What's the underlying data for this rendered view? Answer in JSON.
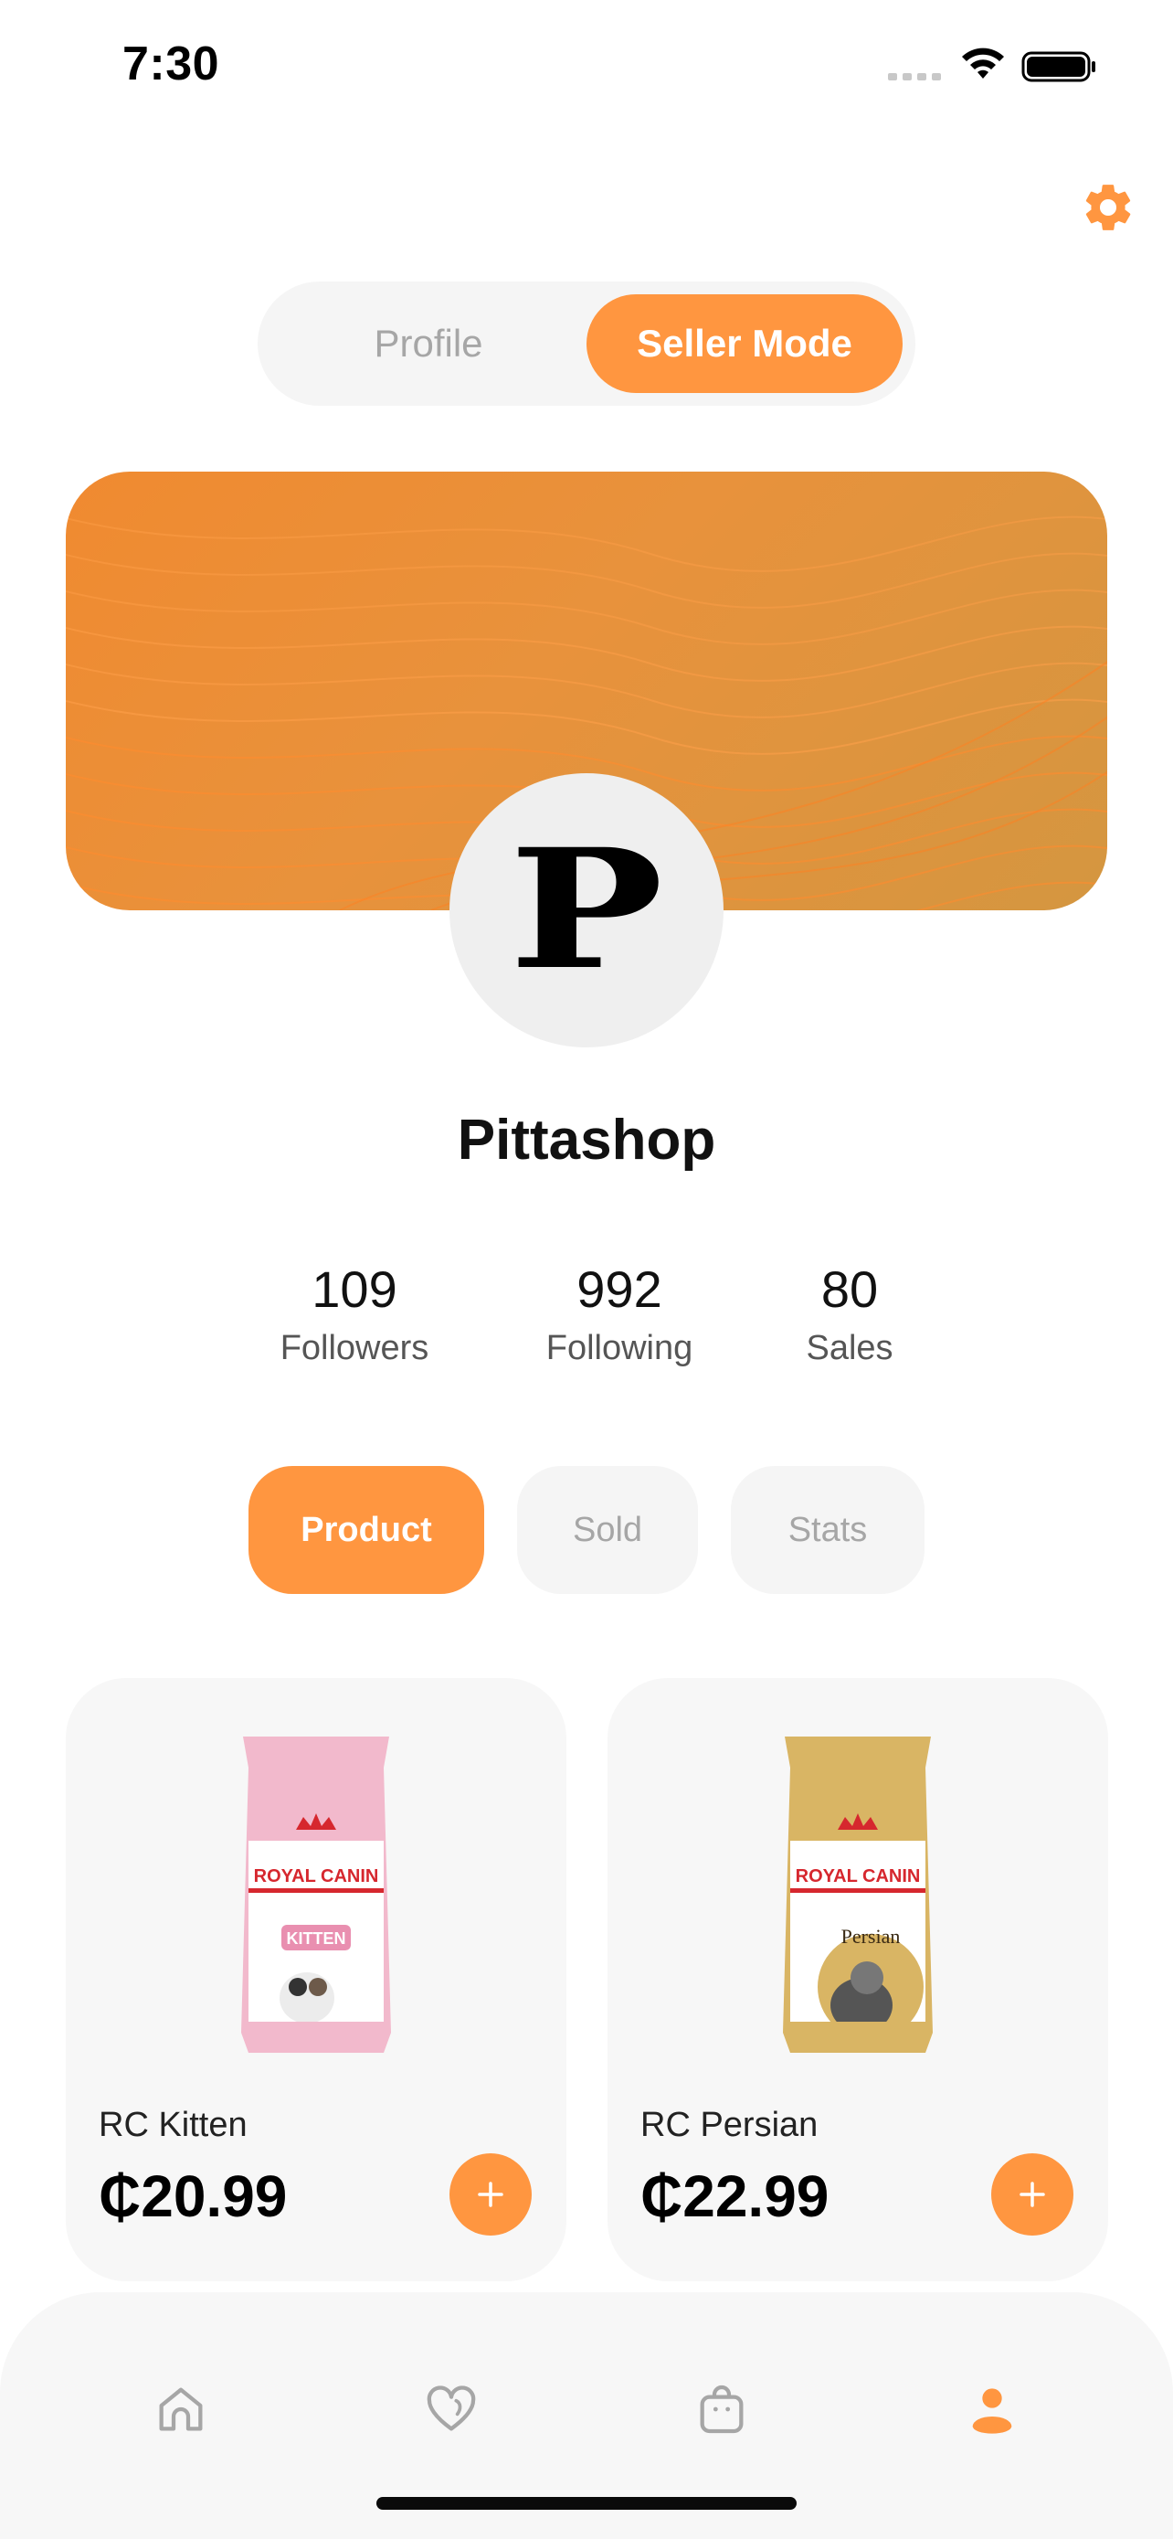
{
  "status_bar": {
    "time": "7:30"
  },
  "colors": {
    "accent": "#ff9640",
    "surface": "#f7f7f7",
    "inactive": "#a6a6a6"
  },
  "mode_toggle": {
    "profile_label": "Profile",
    "seller_label": "Seller Mode",
    "selected": "Seller Mode"
  },
  "profile": {
    "avatar_letter": "P",
    "shop_name": "Pittashop",
    "stats": [
      {
        "value": "109",
        "label": "Followers"
      },
      {
        "value": "992",
        "label": "Following"
      },
      {
        "value": "80",
        "label": "Sales"
      }
    ]
  },
  "tabs": [
    {
      "label": "Product",
      "active": true
    },
    {
      "label": "Sold",
      "active": false
    },
    {
      "label": "Stats",
      "active": false
    }
  ],
  "products": [
    {
      "name": "RC Kitten",
      "price": "₵20.99",
      "brand": "ROYAL CANIN",
      "variant": "KITTEN",
      "bag_color": "#f2b9cc"
    },
    {
      "name": "RC Persian",
      "price": "₵22.99",
      "brand": "ROYAL CANIN",
      "variant": "Persian",
      "bag_color": "#d9b564"
    }
  ],
  "bottom_nav": [
    {
      "icon": "home-icon",
      "active": false
    },
    {
      "icon": "heart-icon",
      "active": false
    },
    {
      "icon": "bag-icon",
      "active": false
    },
    {
      "icon": "profile-icon",
      "active": true
    }
  ]
}
